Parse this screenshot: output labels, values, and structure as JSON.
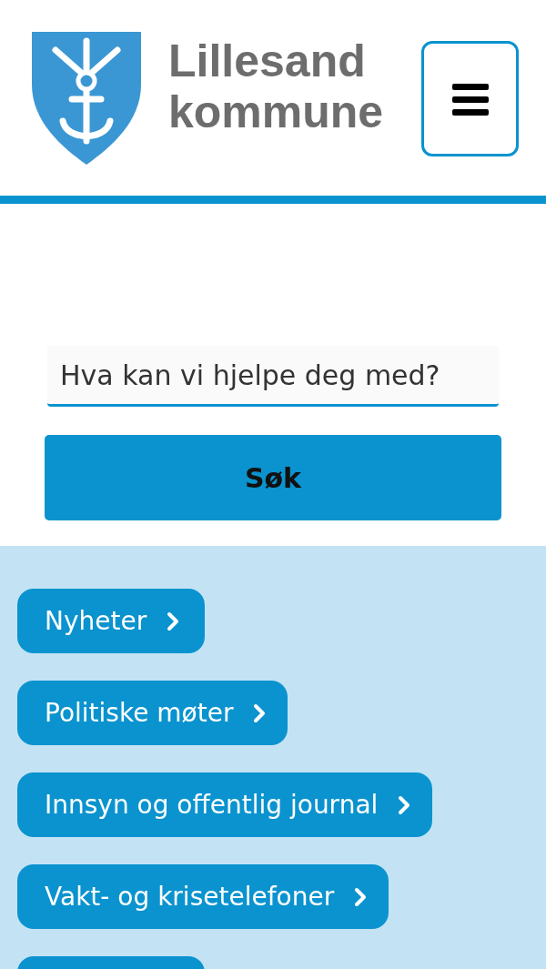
{
  "header": {
    "logo_text": [
      "Lillesand",
      "kommune"
    ]
  },
  "search": {
    "placeholder": "Hva kan vi hjelpe deg med?",
    "button": "Søk"
  },
  "links": [
    {
      "label": "Nyheter"
    },
    {
      "label": "Politiske møter"
    },
    {
      "label": "Innsyn og offentlig journal"
    },
    {
      "label": "Vakt- og krisetelefoner"
    },
    {
      "kind": "partial"
    }
  ]
}
